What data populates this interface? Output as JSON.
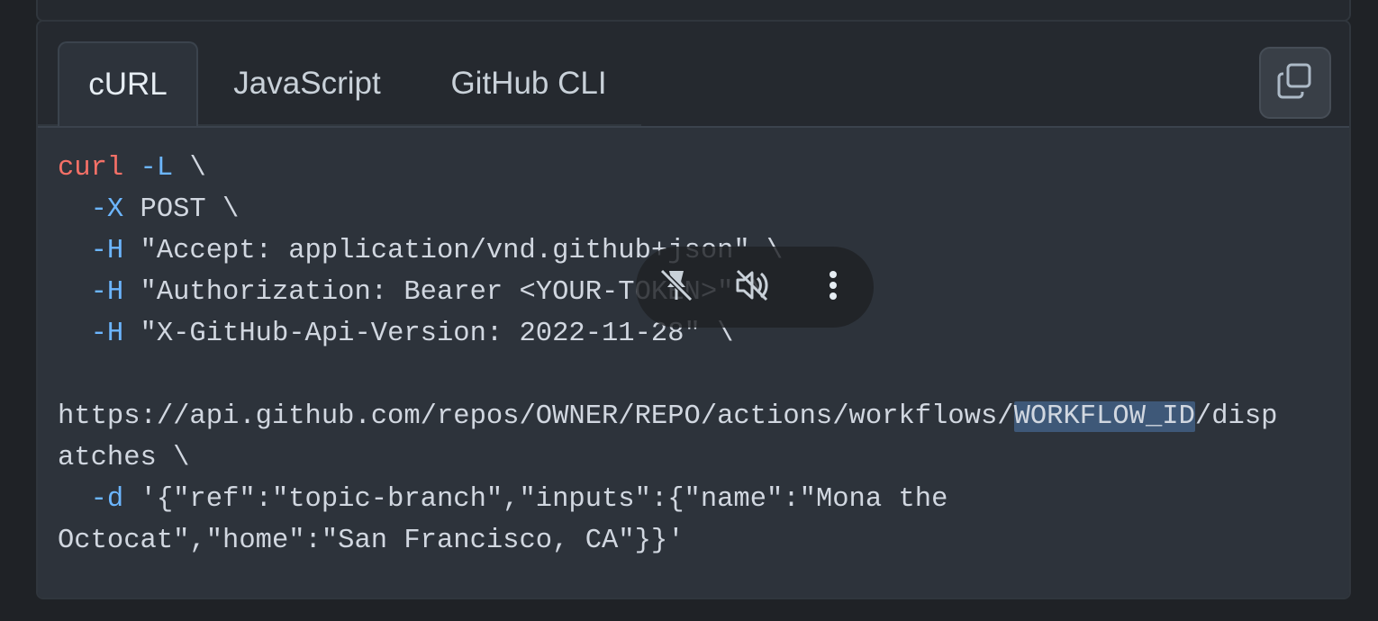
{
  "tabs": [
    {
      "label": "cURL",
      "active": true
    },
    {
      "label": "JavaScript",
      "active": false
    },
    {
      "label": "GitHub CLI",
      "active": false
    }
  ],
  "copy_button": {
    "icon": "copy-icon",
    "title": "Copy to clipboard"
  },
  "code": {
    "line1": {
      "cmd": "curl",
      "flag": "-L",
      "rest": " \\"
    },
    "line2": {
      "flag": "-X",
      "rest": " POST \\"
    },
    "line3": {
      "flag": "-H",
      "rest": " \"Accept: application/vnd.github+json\" \\"
    },
    "line4": {
      "flag": "-H",
      "rest": " \"Authorization: Bearer <YOUR-TOKEN>\" \\"
    },
    "line5": {
      "flag": "-H",
      "rest": " \"X-GitHub-Api-Version: 2022-11-28\" \\"
    },
    "url_before": "https://api.github.com/repos/OWNER/REPO/actions/workflows/",
    "url_selected": "WORKFLOW_ID",
    "url_after": "/disp",
    "url_wrap": "atches \\",
    "line_d": {
      "flag": "-d",
      "rest": " '{\"ref\":\"topic-branch\",\"inputs\":{\"name\":\"Mona the"
    },
    "line_d_wrap": "Octocat\",\"home\":\"San Francisco, CA\"}}'"
  },
  "media_overlay": {
    "icons": [
      "pin-off-icon",
      "volume-off-icon",
      "more-vertical-icon"
    ]
  },
  "colors": {
    "background": "#1f2226",
    "code_bg": "#2d333b",
    "keyword": "#f47067",
    "flag": "#6cb6ff",
    "text": "#d1d7e0",
    "selection": "#3e5878"
  }
}
